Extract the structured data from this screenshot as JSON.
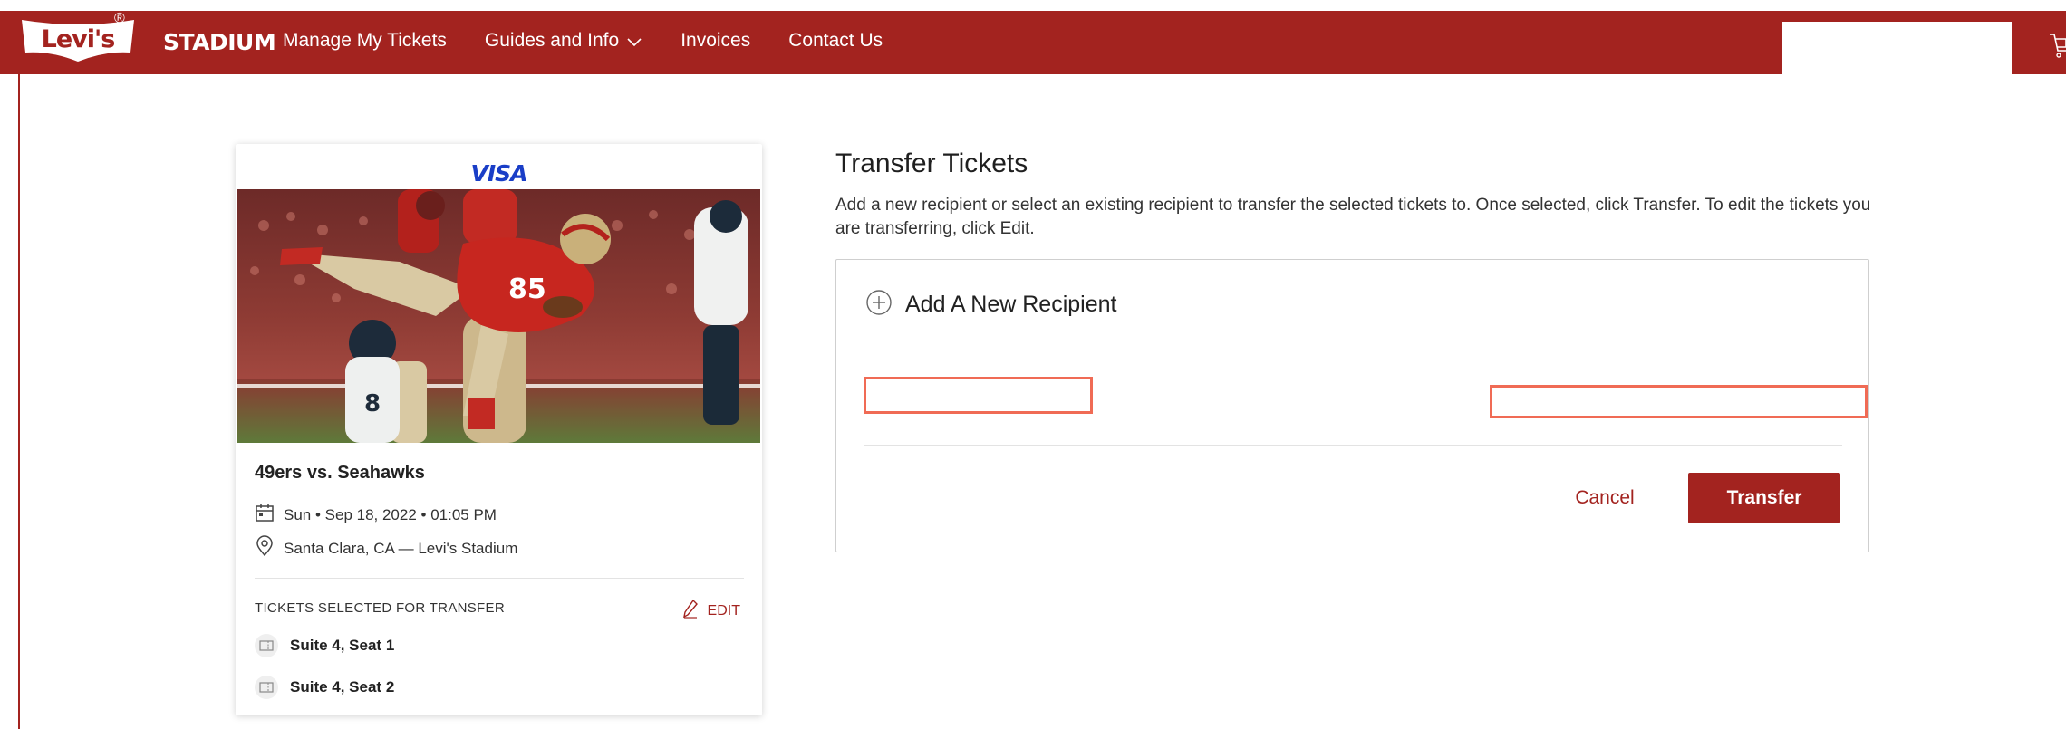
{
  "header": {
    "logo_text": "Levi's",
    "logo_registered": "®",
    "logo_suffix": "STADIUM",
    "nav": [
      {
        "label": "Manage My Tickets"
      },
      {
        "label": "Guides and Info"
      },
      {
        "label": "Invoices"
      },
      {
        "label": "Contact Us"
      }
    ],
    "accent_color": "#a3231f"
  },
  "event": {
    "sponsor": "VISA",
    "title": "49ers vs. Seahawks",
    "datetime": "Sun • Sep 18, 2022 • 01:05 PM",
    "venue": "Santa Clara, CA — Levi's Stadium",
    "selected_heading": "TICKETS SELECTED FOR TRANSFER",
    "edit_label": "EDIT",
    "seats": [
      {
        "label": "Suite 4, Seat 1"
      },
      {
        "label": "Suite 4, Seat 2"
      }
    ]
  },
  "transfer": {
    "title": "Transfer Tickets",
    "description": "Add a new recipient or select an existing recipient to transfer the selected tickets to. Once selected, click Transfer. To edit the tickets you are transferring, click Edit.",
    "add_recipient_label": "Add A New Recipient",
    "cancel_label": "Cancel",
    "transfer_label": "Transfer"
  },
  "icons": {
    "chevron": "chevron-down-icon",
    "cart": "cart-icon",
    "calendar": "calendar-icon",
    "location": "location-pin-icon",
    "edit": "pencil-icon",
    "ticket": "ticket-icon",
    "add": "plus-circle-icon"
  }
}
